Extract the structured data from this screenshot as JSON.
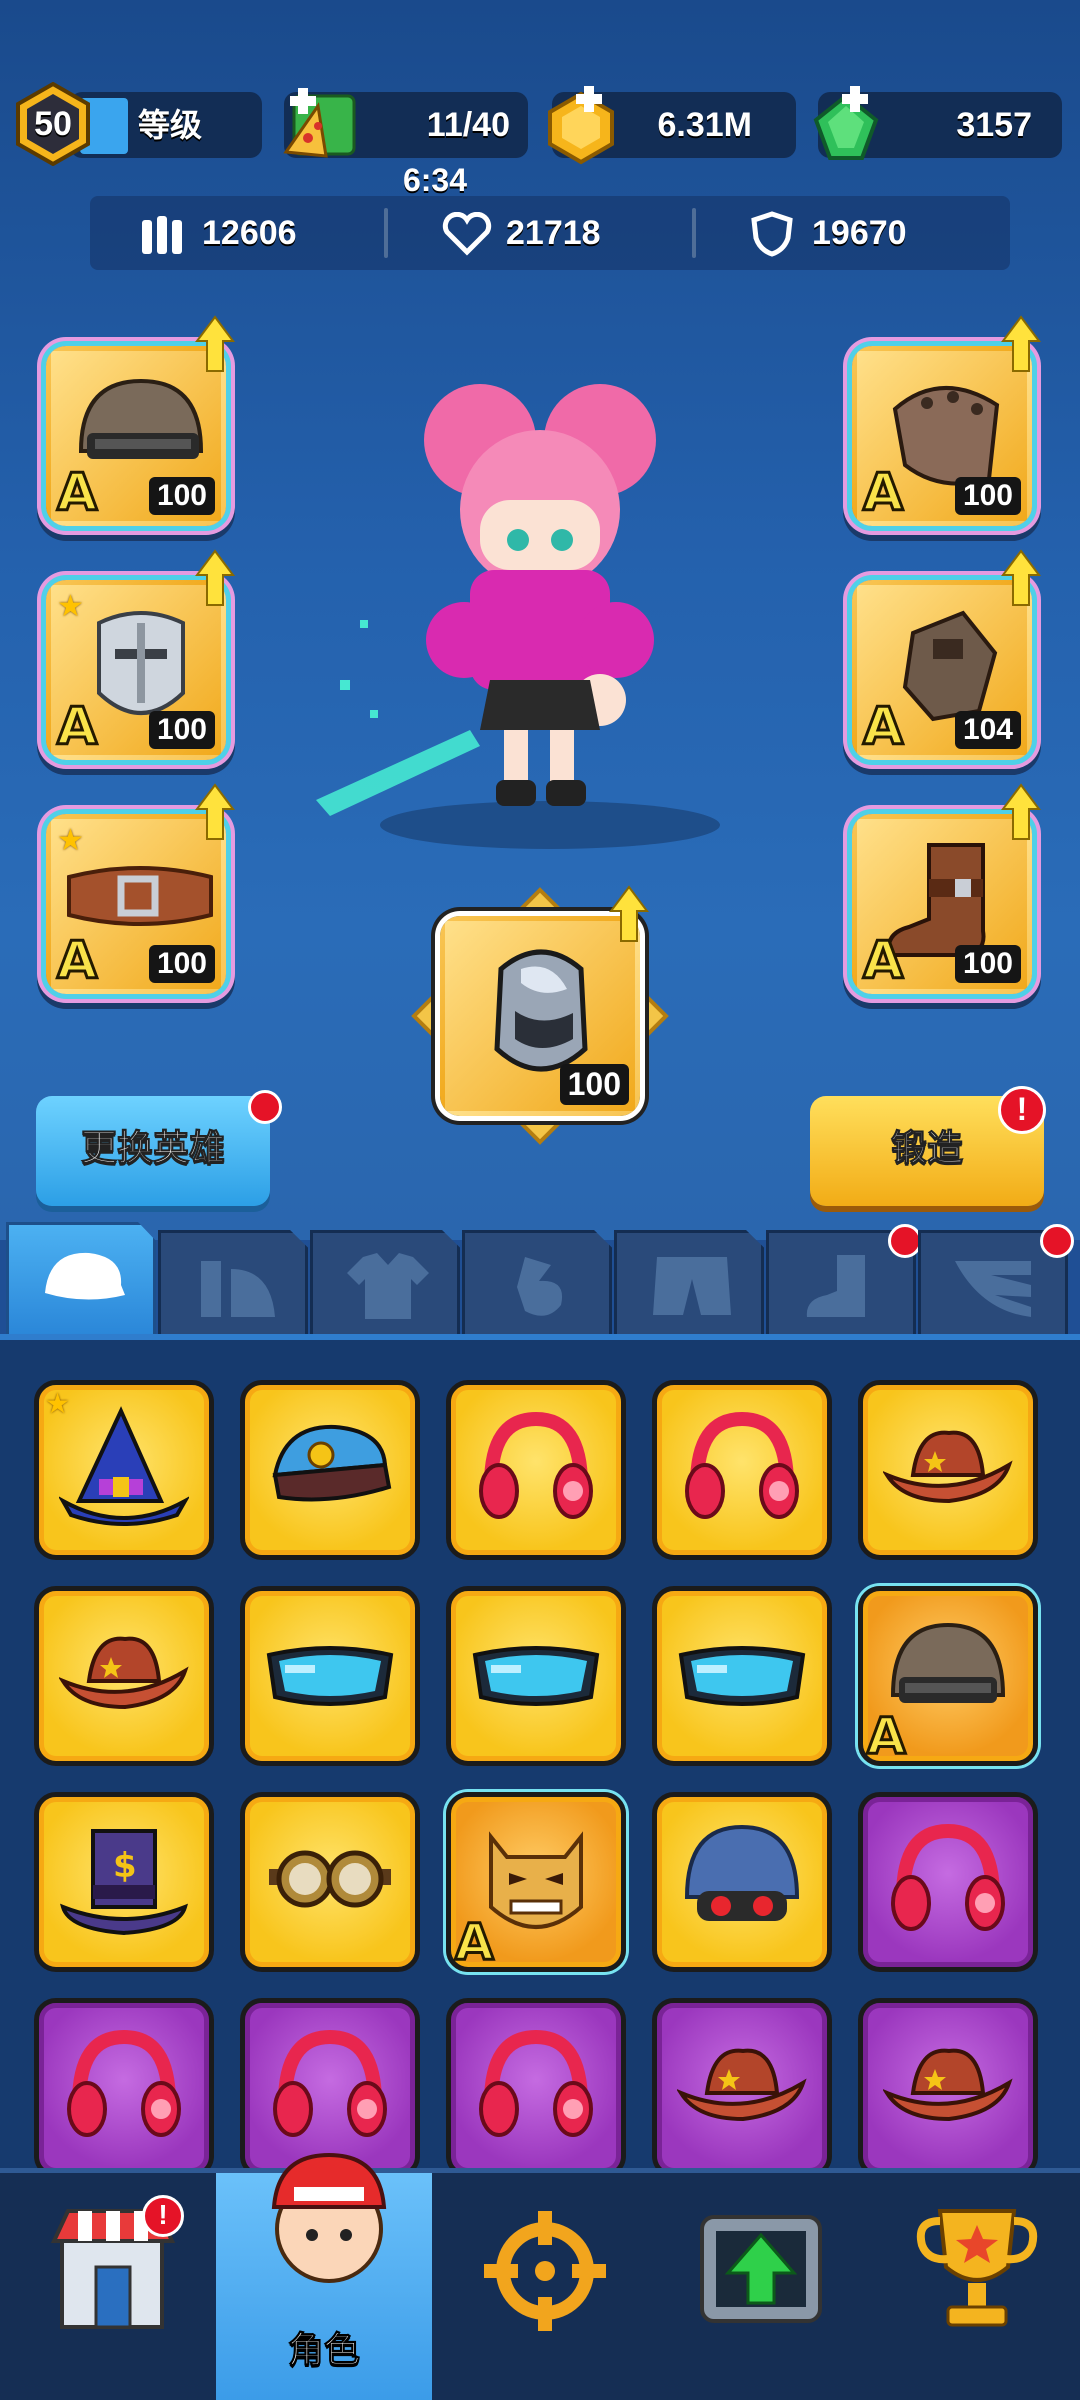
{
  "header": {
    "level": "50",
    "level_label": "等级",
    "energy": "11/40",
    "energy_timer": "6:34",
    "gold": "6.31M",
    "gems": "3157"
  },
  "stats": {
    "attack": "12606",
    "health": "21718",
    "defense": "19670"
  },
  "equipment": {
    "left": [
      {
        "name": "helmet",
        "grade": "A",
        "level": "100",
        "starred": false
      },
      {
        "name": "armor",
        "grade": "A",
        "level": "100",
        "starred": true
      },
      {
        "name": "belt",
        "grade": "A",
        "level": "100",
        "starred": true
      }
    ],
    "right": [
      {
        "name": "shoulder",
        "grade": "A",
        "level": "100"
      },
      {
        "name": "glove",
        "grade": "A",
        "level": "104"
      },
      {
        "name": "boot",
        "grade": "A",
        "level": "100"
      }
    ],
    "center": {
      "name": "core",
      "level": "100"
    }
  },
  "buttons": {
    "change_hero": "更换英雄",
    "forge": "锻造"
  },
  "tabs": [
    "hat",
    "shoulder",
    "shirt",
    "glove",
    "pants",
    "boots",
    "wings"
  ],
  "inventory": [
    {
      "name": "wizard-hat",
      "rarity": "gold",
      "starred": true
    },
    {
      "name": "police-cap",
      "rarity": "gold"
    },
    {
      "name": "headphones",
      "rarity": "gold"
    },
    {
      "name": "headphones",
      "rarity": "gold"
    },
    {
      "name": "cowboy-hat",
      "rarity": "gold"
    },
    {
      "name": "cowboy-hat",
      "rarity": "gold"
    },
    {
      "name": "goggles",
      "rarity": "gold"
    },
    {
      "name": "goggles",
      "rarity": "gold"
    },
    {
      "name": "goggles",
      "rarity": "gold"
    },
    {
      "name": "helmet",
      "rarity": "orange",
      "grade": "A"
    },
    {
      "name": "top-hat",
      "rarity": "gold"
    },
    {
      "name": "steampunk-goggles",
      "rarity": "gold"
    },
    {
      "name": "oni-mask",
      "rarity": "orange",
      "grade": "A"
    },
    {
      "name": "combat-helmet",
      "rarity": "gold"
    },
    {
      "name": "headphones",
      "rarity": "purple"
    },
    {
      "name": "headphones",
      "rarity": "purple"
    },
    {
      "name": "headphones",
      "rarity": "purple"
    },
    {
      "name": "headphones",
      "rarity": "purple"
    },
    {
      "name": "cowboy-hat",
      "rarity": "purple"
    },
    {
      "name": "cowboy-hat",
      "rarity": "purple"
    }
  ],
  "nav": [
    {
      "name": "shop",
      "label": ""
    },
    {
      "name": "character",
      "label": "角色"
    },
    {
      "name": "battle",
      "label": ""
    },
    {
      "name": "upgrade",
      "label": ""
    },
    {
      "name": "ranking",
      "label": ""
    }
  ],
  "colors": {
    "gold_slot": "#f8c51c",
    "purple_slot": "#9b37be",
    "button_blue": "#2c9fe6",
    "button_yellow": "#f2ac16",
    "badge_red": "#e51327"
  }
}
